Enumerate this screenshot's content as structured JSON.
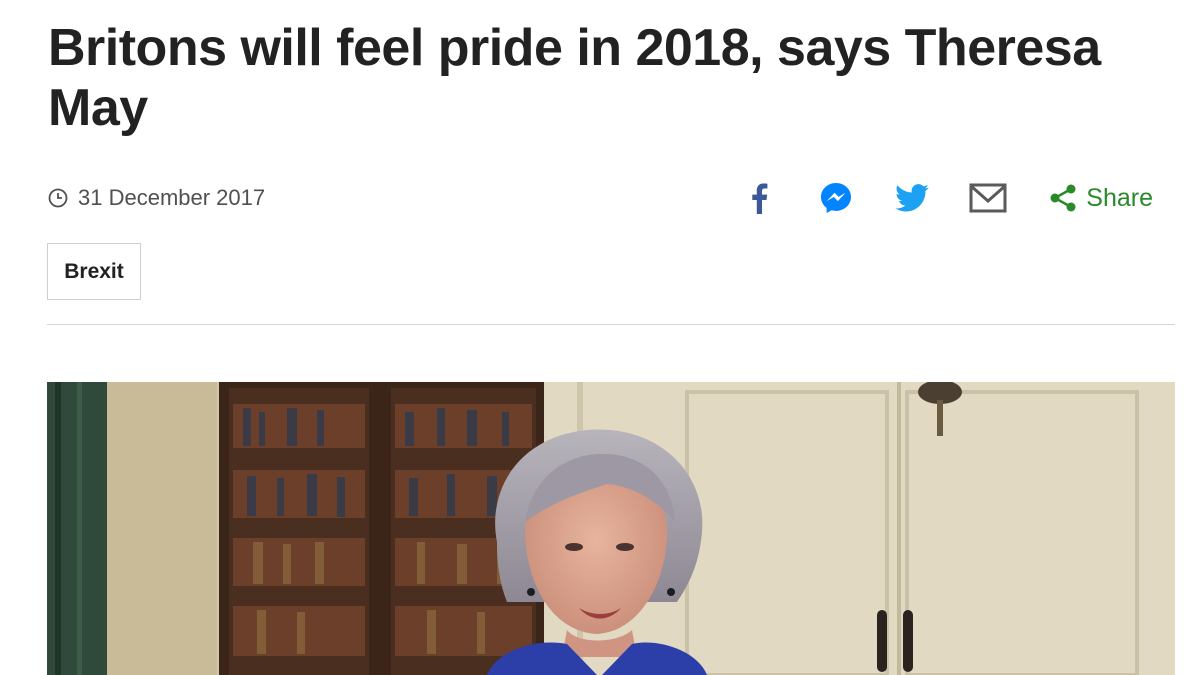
{
  "article": {
    "headline": "Britons will feel pride in 2018, says Theresa May",
    "date": "31 December 2017",
    "tag": "Brexit"
  },
  "share": {
    "items": [
      {
        "icon": "facebook-icon",
        "color": "#3b5998"
      },
      {
        "icon": "messenger-icon",
        "color": "#0084ff"
      },
      {
        "icon": "twitter-icon",
        "color": "#1da1f2"
      },
      {
        "icon": "email-icon",
        "color": "#5a5a5a"
      }
    ],
    "more_label": "Share",
    "more_color": "#2a8a2a"
  },
  "media": {
    "type": "video-still"
  }
}
